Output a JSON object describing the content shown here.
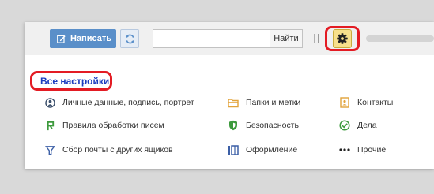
{
  "toolbar": {
    "compose_label": "Написать",
    "search_value": "",
    "search_button": "Найти"
  },
  "settings": {
    "title": "Все настройки",
    "col1": [
      "Личные данные, подпись, портрет",
      "Правила обработки писем",
      "Сбор почты с других ящиков"
    ],
    "col2": [
      "Папки и метки",
      "Безопасность",
      "Оформление"
    ],
    "col3": [
      "Контакты",
      "Дела",
      "Прочие"
    ]
  },
  "colors": {
    "compose_bg": "#5a8fc9",
    "gear_bg": "#f7e08c",
    "highlight": "#e31b23",
    "title": "#1a3cbf"
  },
  "icons": {
    "compose": "pencil-icon",
    "refresh": "refresh-icon",
    "settings": "gear-icon",
    "personal": "person-icon",
    "rules": "filter-icon",
    "collector": "funnel-icon",
    "folders": "folder-icon",
    "security": "shield-icon",
    "theme": "theme-icon",
    "contacts": "contacts-icon",
    "todo": "check-circle-icon",
    "other": "dots-icon"
  }
}
